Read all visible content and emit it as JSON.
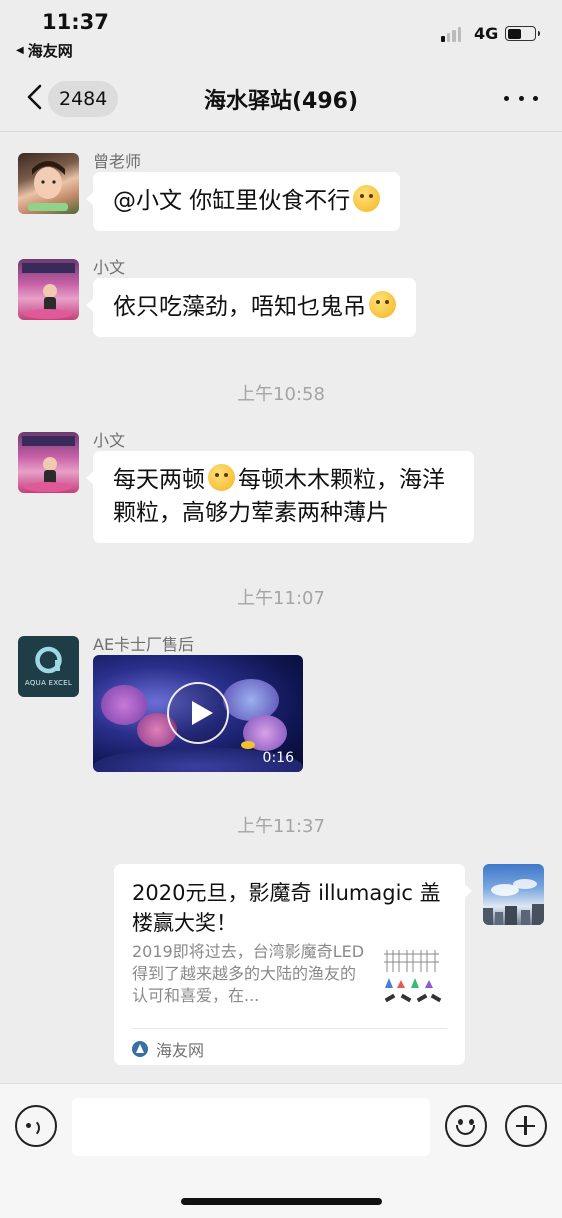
{
  "status_bar": {
    "time": "11:37",
    "back_app": "海友网",
    "network": "4G",
    "battery_level": 0.5
  },
  "nav": {
    "unread_count": "2484",
    "title": "海水驿站(496)"
  },
  "messages": [
    {
      "sender": "曾老师",
      "text": "@小文 你缸里伙食不行",
      "emoji": "squinting-tongue-emoji"
    },
    {
      "sender": "小文",
      "text": "依只吃藻劲，唔知乜鬼吊",
      "emoji": "thinking-emoji"
    },
    {
      "timestamp": "上午10:58"
    },
    {
      "sender": "小文",
      "text_part1": "每天两顿",
      "emoji": "crying-laughing-emoji",
      "text_part2": "每顿木木颗粒，海洋颗粒，高够力荤素两种薄片"
    },
    {
      "timestamp": "上午11:07"
    },
    {
      "sender": "AE卡士厂售后",
      "avatar_label": "AQUA EXCEL",
      "video_duration": "0:16"
    },
    {
      "timestamp": "上午11:37"
    },
    {
      "sender": "me",
      "card_title": "2020元旦，影魔奇 illumagic 盖楼赢大奖！",
      "card_desc": "2019即将过去，台湾影魔奇LED得到了越来越多的大陆的渔友的认可和喜爱，在...",
      "card_source": "海友网"
    }
  ],
  "colors": {
    "background": "#ededed",
    "bubble": "#ffffff",
    "timestamp": "#a5a5a5"
  }
}
